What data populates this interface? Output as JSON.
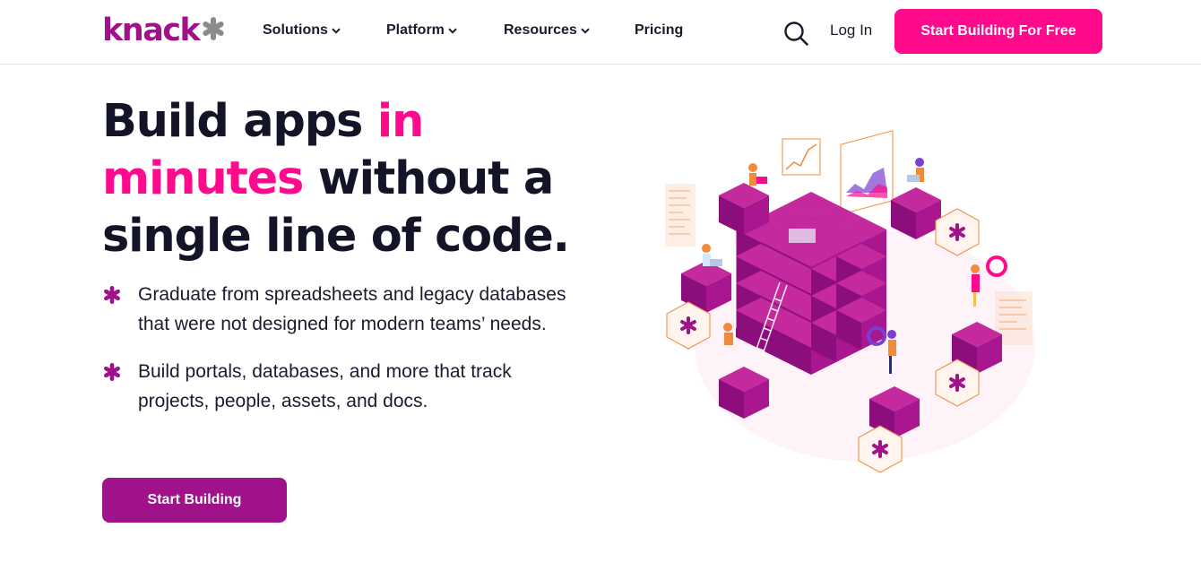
{
  "brand": {
    "logo_text": "knack",
    "primary_color": "#a0128a",
    "accent_color": "#ff0a8c"
  },
  "nav": {
    "items": [
      {
        "label": "Solutions",
        "has_dropdown": true
      },
      {
        "label": "Platform",
        "has_dropdown": true
      },
      {
        "label": "Resources",
        "has_dropdown": true
      },
      {
        "label": "Pricing",
        "has_dropdown": false
      }
    ],
    "search_icon": "search-icon",
    "login_label": "Log In",
    "cta_label": "Start Building For Free"
  },
  "hero": {
    "title_part1": "Build apps ",
    "title_accent": "in minutes",
    "title_part2": " without a single line of code.",
    "bullets": [
      "Graduate from spreadsheets and legacy databases that were not designed for modern teams’ needs.",
      "Build portals, databases, and more that track projects, people, assets, and docs."
    ],
    "cta_label": "Start Building"
  }
}
